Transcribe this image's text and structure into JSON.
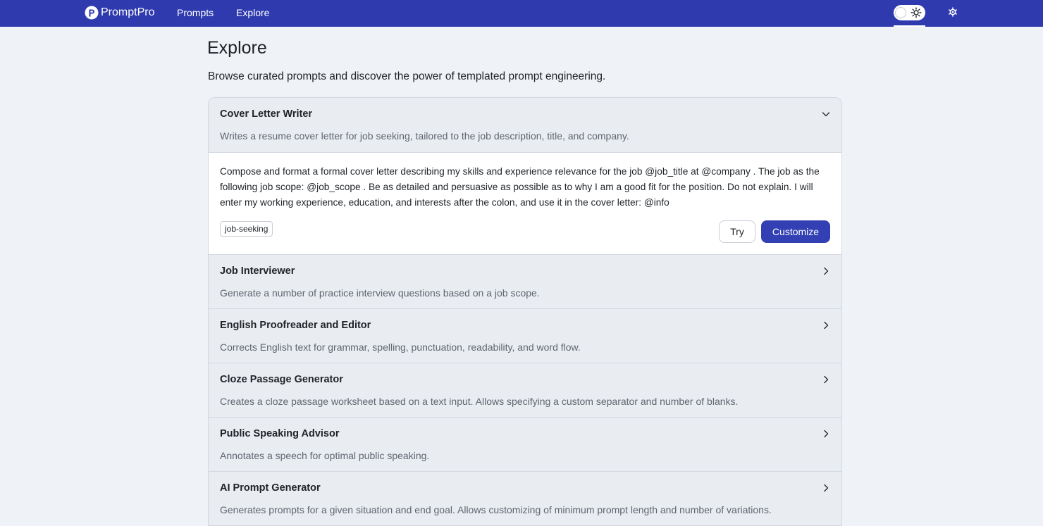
{
  "nav": {
    "brand": "PromptPro",
    "links": [
      "Prompts",
      "Explore"
    ]
  },
  "page": {
    "title": "Explore",
    "subtitle": "Browse curated prompts and discover the power of templated prompt engineering."
  },
  "prompts": [
    {
      "title": "Cover Letter Writer",
      "description": "Writes a resume cover letter for job seeking, tailored to the job description, title, and company.",
      "expanded": true,
      "template": "Compose and format a formal cover letter describing my skills and experience relevance for the job @job_title at @company . The job as the following job scope: @job_scope . Be as detailed and persuasive as possible as to why I am a good fit for the position. Do not explain. I will enter my working experience, education, and interests after the colon, and use it in the cover letter: @info",
      "tag": "job-seeking",
      "actions": {
        "try": "Try",
        "customize": "Customize"
      }
    },
    {
      "title": "Job Interviewer",
      "description": "Generate a number of practice interview questions based on a job scope."
    },
    {
      "title": "English Proofreader and Editor",
      "description": "Corrects English text for grammar, spelling, punctuation, readability, and word flow."
    },
    {
      "title": "Cloze Passage Generator",
      "description": "Creates a cloze passage worksheet based on a text input. Allows specifying a custom separator and number of blanks."
    },
    {
      "title": "Public Speaking Advisor",
      "description": "Annotates a speech for optimal public speaking."
    },
    {
      "title": "AI Prompt Generator",
      "description": "Generates prompts for a given situation and end goal. Allows customizing of minimum prompt length and number of variations."
    }
  ],
  "icons": {
    "logo": "promptpro-logo-icon",
    "theme": "sun-icon",
    "settings": "gear-icon",
    "expanded": "chevron-down-icon",
    "collapsed": "chevron-right-icon"
  },
  "colors": {
    "nav_bg": "#2e3aae",
    "primary_button": "#3240b4",
    "page_bg": "#eff2f6"
  }
}
